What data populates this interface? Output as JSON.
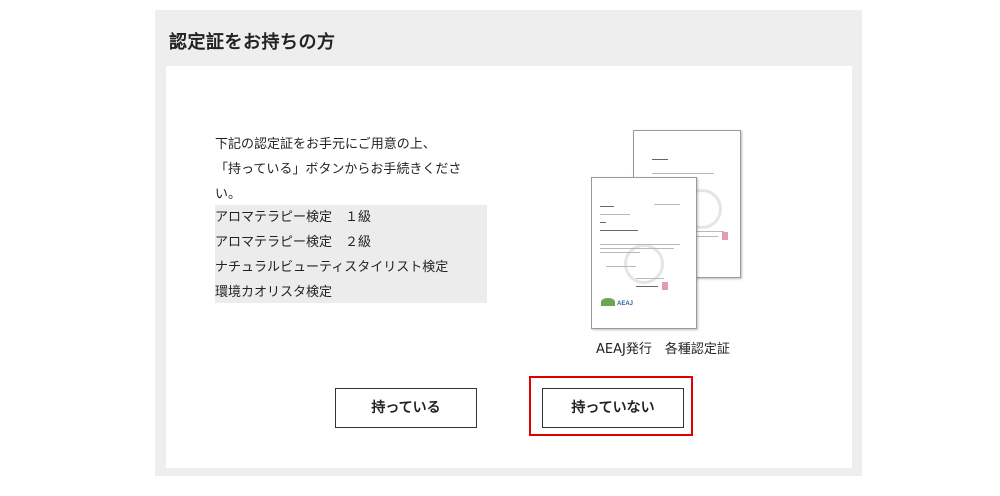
{
  "section": {
    "title": "認定証をお持ちの方"
  },
  "intro": {
    "line1": "下記の認定証をお手元にご用意の上、",
    "line2": "「持っている」ボタンからお手続きくださ",
    "line3": "い。"
  },
  "certificates": [
    "アロマテラピー検定　１級",
    "アロマテラピー検定　２級",
    "ナチュラルビューティスタイリスト検定",
    "環境カオリスタ検定"
  ],
  "illustration": {
    "caption": "AEAJ発行　各種認定証",
    "logo_text": "AEAJ",
    "back_doc_heading": "認 定 証",
    "front_doc_heading": "認 定 証",
    "front_doc_grade": "１級",
    "stamp_color": "#e59ab3"
  },
  "buttons": {
    "have_label": "持っている",
    "have_not_label": "持っていない"
  },
  "colors": {
    "panel_bg": "#eeeeee",
    "list_bg": "#ececec",
    "highlight": "#e00000"
  }
}
